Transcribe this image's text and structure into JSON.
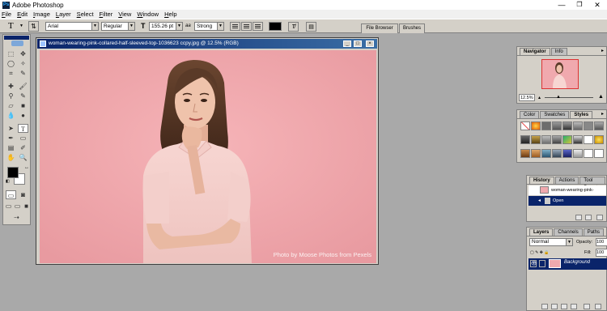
{
  "app": {
    "title": "Adobe Photoshop",
    "window_controls": [
      "—",
      "❐",
      "✕"
    ]
  },
  "menu": [
    "File",
    "Edit",
    "Image",
    "Layer",
    "Select",
    "Filter",
    "View",
    "Window",
    "Help"
  ],
  "options_bar": {
    "tool_glyph": "T",
    "font_family": "Arial",
    "font_style": "Regular",
    "font_size": "155.26 pt",
    "aa_glyph": "aa",
    "antialias": "Strong",
    "text_color": "#000000",
    "palette_well_tabs": [
      "File Browser",
      "Brushes"
    ]
  },
  "toolbox": {
    "foreground_color": "#000000",
    "background_color": "#ffffff"
  },
  "document": {
    "title": "woman-wearing-pink-collared-half-sleeved-top-1036623 ccpy.jpg @ 12.5% (RGB)",
    "credit": "Photo by Moose Photos from Pexels",
    "background_color": "#f0a9ae"
  },
  "navigator": {
    "tabs": [
      "Navigator",
      "Info"
    ],
    "zoom": "12.5%"
  },
  "styles_palette": {
    "tabs": [
      "Color",
      "Swatches",
      "Styles"
    ]
  },
  "history_palette": {
    "tabs": [
      "History",
      "Actions",
      "Tool Presets"
    ],
    "snapshot": "woman-wearing-pink-colla...",
    "states": [
      "Open"
    ]
  },
  "layers_palette": {
    "tabs": [
      "Layers",
      "Channels",
      "Paths"
    ],
    "blend_mode": "Normal",
    "opacity_label": "Opacity:",
    "opacity": "100",
    "fill_label": "Fill:",
    "fill": "100",
    "layers": [
      "Background"
    ]
  }
}
